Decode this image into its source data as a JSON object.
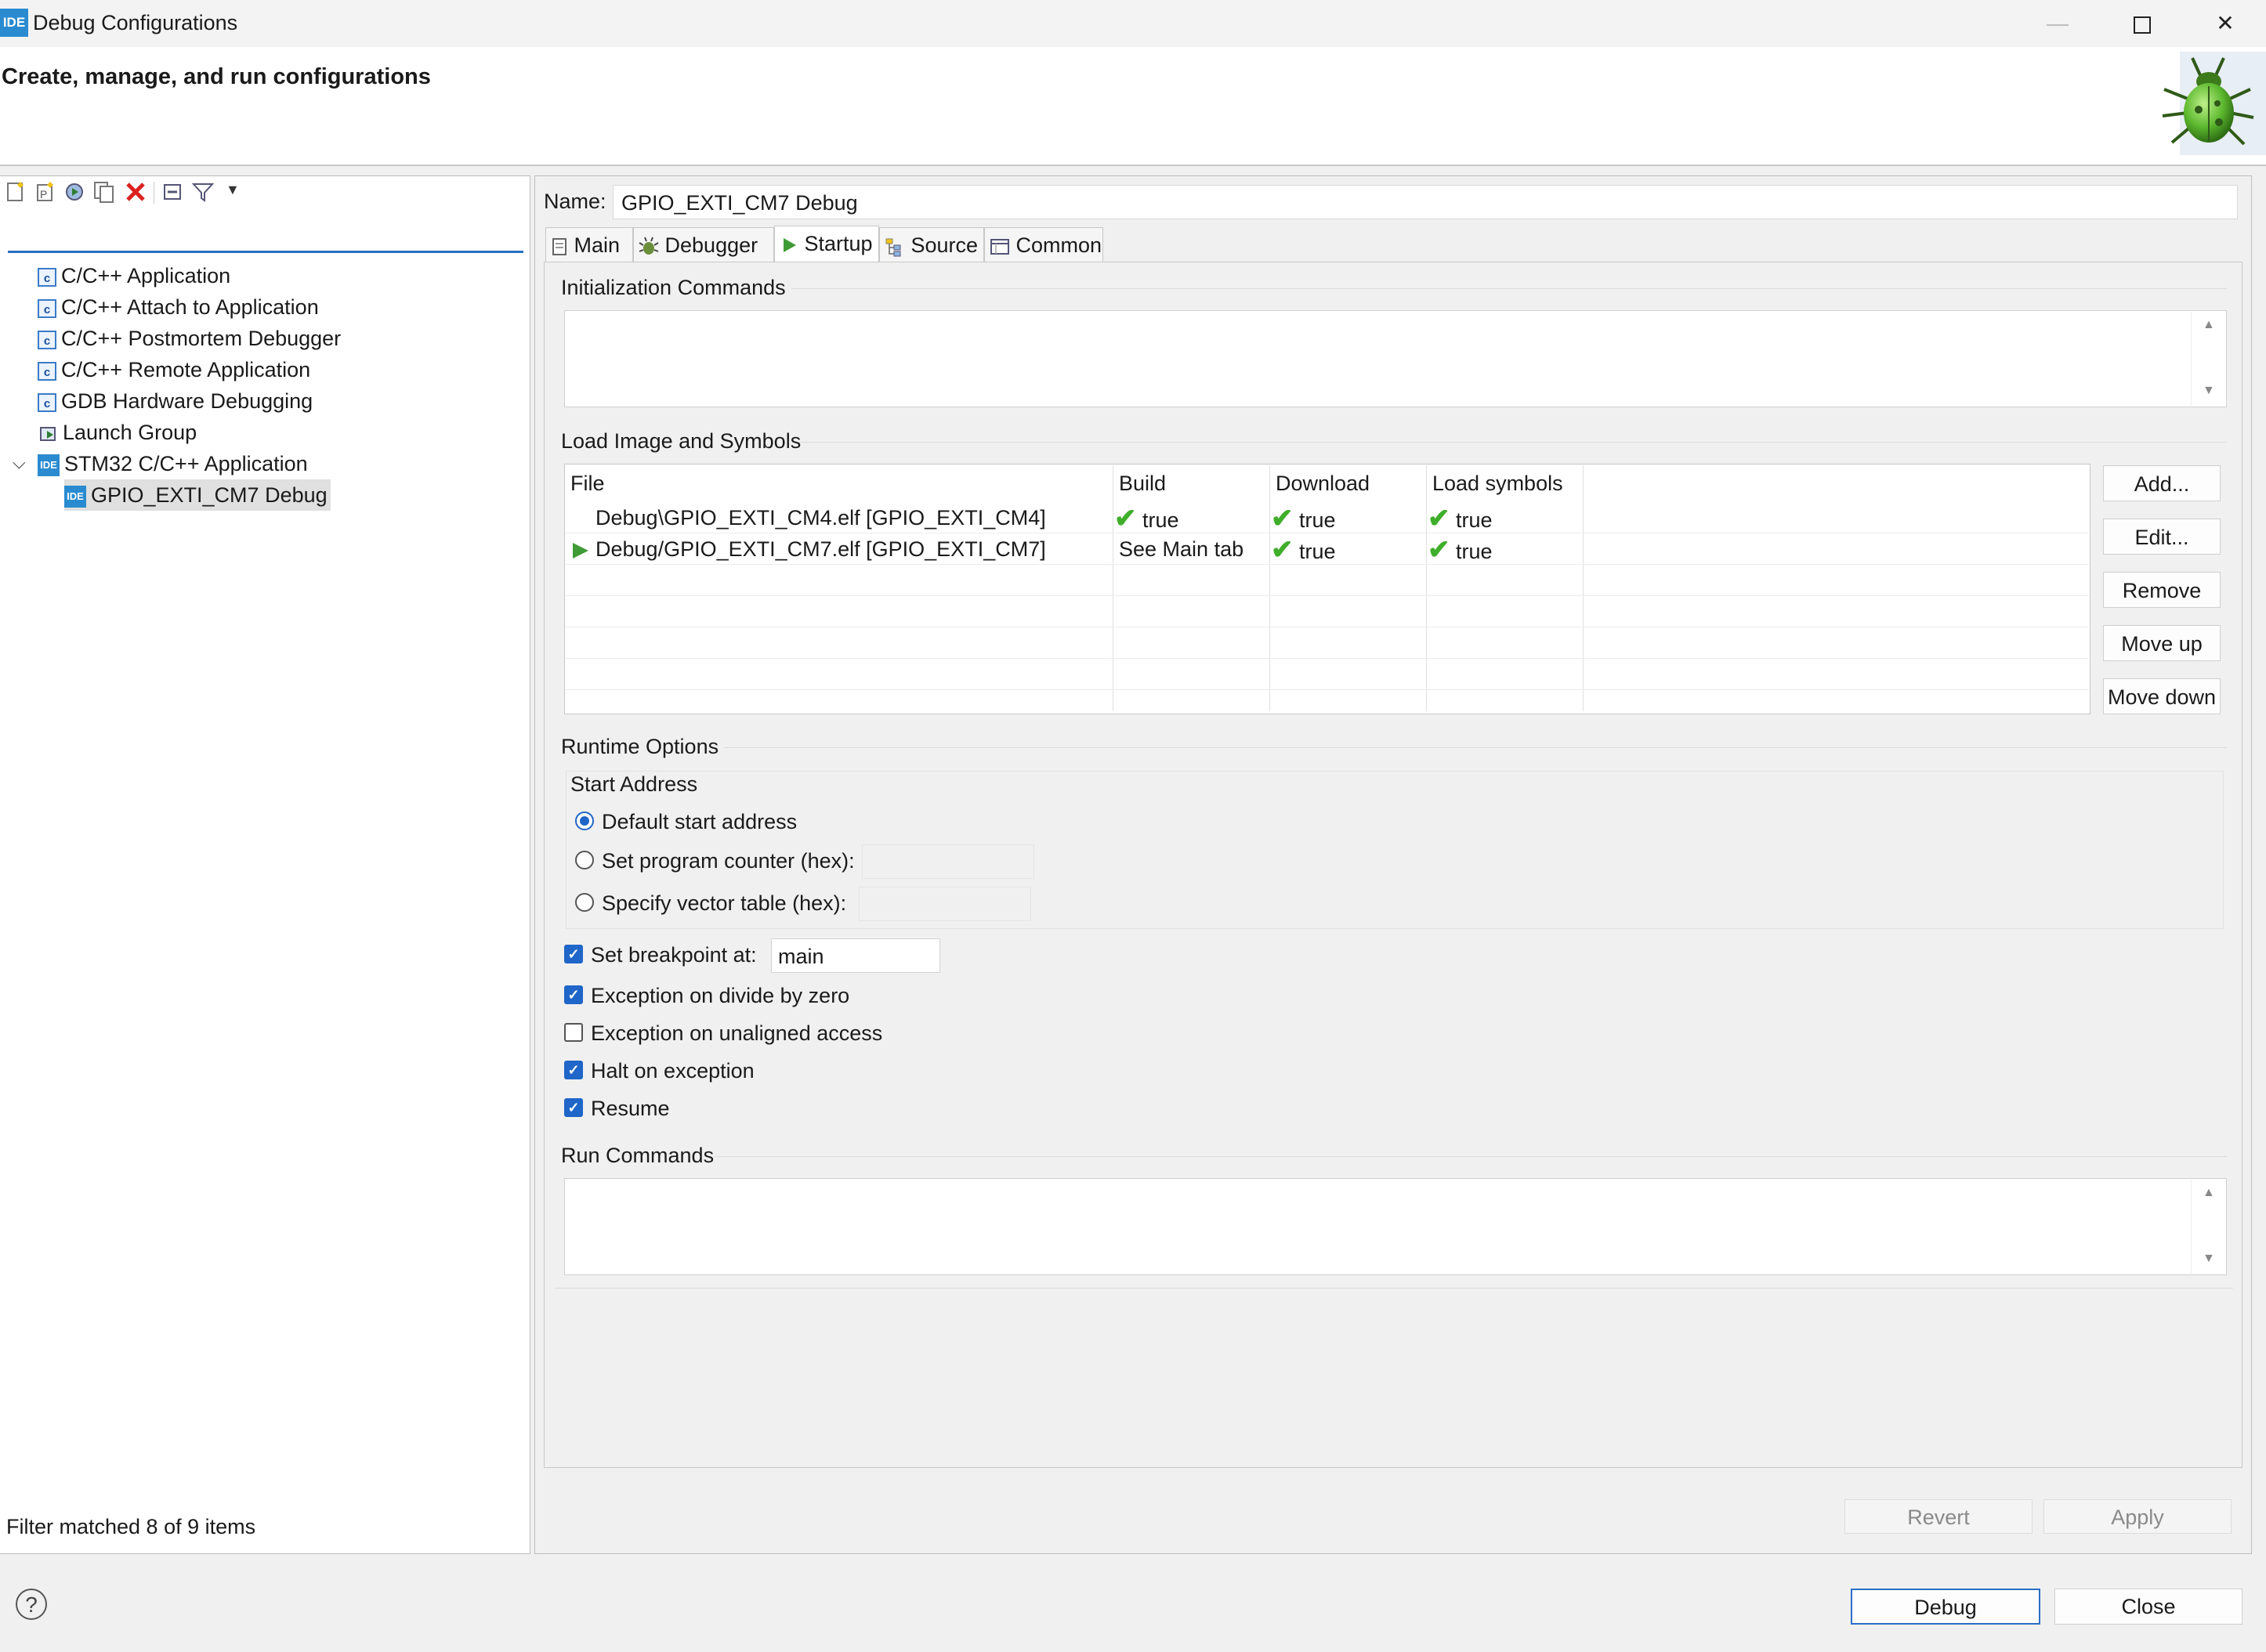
{
  "window": {
    "title": "Debug Configurations",
    "logo_text": "IDE",
    "header_title": "Create, manage, and run configurations"
  },
  "sidebar": {
    "filter_placeholder": "",
    "items": [
      {
        "label": "C/C++ Application",
        "icon": "c-config-icon"
      },
      {
        "label": "C/C++ Attach to Application",
        "icon": "c-config-icon"
      },
      {
        "label": "C/C++ Postmortem Debugger",
        "icon": "c-config-icon"
      },
      {
        "label": "C/C++ Remote Application",
        "icon": "c-config-icon"
      },
      {
        "label": "GDB Hardware Debugging",
        "icon": "c-config-icon"
      },
      {
        "label": "Launch Group",
        "icon": "launch-group-icon"
      },
      {
        "label": "STM32 C/C++ Application",
        "icon": "ide-icon",
        "expanded": true
      },
      {
        "label": "GPIO_EXTI_CM7 Debug",
        "icon": "ide-icon",
        "selected": true
      }
    ],
    "status": "Filter matched 8 of 9 items"
  },
  "config": {
    "name_label": "Name:",
    "name_value": "GPIO_EXTI_CM7 Debug",
    "tabs": [
      {
        "label": "Main"
      },
      {
        "label": "Debugger"
      },
      {
        "label": "Startup",
        "active": true
      },
      {
        "label": "Source"
      },
      {
        "label": "Common"
      }
    ],
    "init_commands_label": "Initialization Commands",
    "load_image_label": "Load Image and Symbols",
    "table": {
      "headers": [
        "File",
        "Build",
        "Download",
        "Load symbols"
      ],
      "rows": [
        {
          "file": "Debug\\GPIO_EXTI_CM4.elf [GPIO_EXTI_CM4]",
          "build": "true",
          "download": "true",
          "symbols": "true"
        },
        {
          "file": "Debug/GPIO_EXTI_CM7.elf [GPIO_EXTI_CM7]",
          "build": "See Main tab",
          "download": "true",
          "symbols": "true"
        }
      ]
    },
    "table_buttons": [
      "Add...",
      "Edit...",
      "Remove",
      "Move up",
      "Move down"
    ],
    "runtime_label": "Runtime Options",
    "start_address_label": "Start Address",
    "radio_default": "Default start address",
    "radio_pc": "Set program counter (hex):",
    "radio_vector": "Specify vector table (hex):",
    "set_breakpoint_label": "Set breakpoint at:",
    "breakpoint_value": "main",
    "exception_divide": "Exception on divide by zero",
    "exception_unaligned": "Exception on unaligned access",
    "halt_on_exception": "Halt on exception",
    "resume": "Resume",
    "run_commands_label": "Run Commands",
    "revert": "Revert",
    "apply": "Apply"
  },
  "footer": {
    "debug": "Debug",
    "close": "Close",
    "help": "?"
  },
  "colors": {
    "accent": "#1f66c8",
    "check_green": "#3fae2a",
    "ide_blue": "#2a8bd0"
  }
}
